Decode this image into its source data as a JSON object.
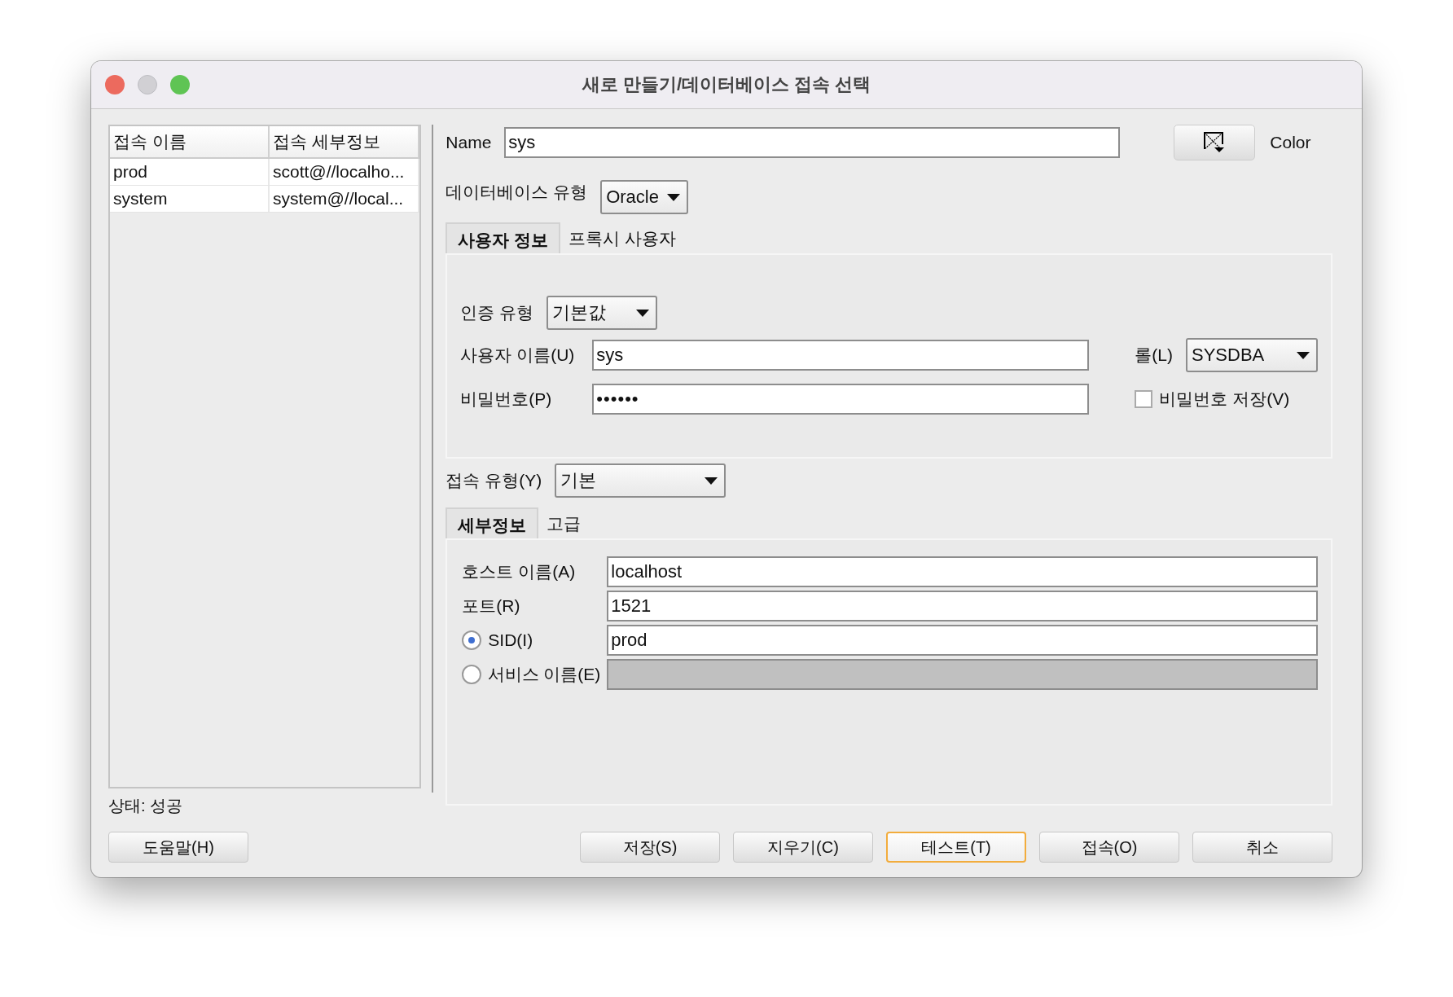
{
  "window": {
    "title": "새로 만들기/데이터베이스 접속 선택"
  },
  "connections": {
    "columns": [
      "접속 이름",
      "접속 세부정보"
    ],
    "rows": [
      {
        "name": "prod",
        "details": "scott@//localho..."
      },
      {
        "name": "system",
        "details": "system@//local..."
      }
    ]
  },
  "name": {
    "label": "Name",
    "value": "sys"
  },
  "color": {
    "label": "Color"
  },
  "database_type": {
    "label": "데이터베이스 유형",
    "value": "Oracle"
  },
  "user_tabs": [
    {
      "label": "사용자 정보",
      "selected": true
    },
    {
      "label": "프록시 사용자",
      "selected": false
    }
  ],
  "auth_type": {
    "label": "인증 유형",
    "value": "기본값"
  },
  "username": {
    "label": "사용자 이름(U)",
    "value": "sys"
  },
  "role": {
    "label": "롤(L)",
    "value": "SYSDBA"
  },
  "password": {
    "label": "비밀번호(P)",
    "value": "••••••"
  },
  "save_password": {
    "label": "비밀번호 저장(V)",
    "checked": false
  },
  "connection_type": {
    "label": "접속 유형(Y)",
    "value": "기본"
  },
  "detail_tabs": [
    {
      "label": "세부정보",
      "selected": true
    },
    {
      "label": "고급",
      "selected": false
    }
  ],
  "host": {
    "label": "호스트 이름(A)",
    "value": "localhost"
  },
  "port": {
    "label": "포트(R)",
    "value": "1521"
  },
  "sid": {
    "label": "SID(I)",
    "selected": true,
    "value": "prod",
    "disabled": false
  },
  "service_name": {
    "label": "서비스 이름(E)",
    "selected": false,
    "disabled": true
  },
  "status": "상태: 성공",
  "help_button": {
    "label": "도움말(H)",
    "focused": false
  },
  "buttons": [
    {
      "label": "저장(S)",
      "focused": false
    },
    {
      "label": "지우기(C)",
      "focused": false
    },
    {
      "label": "테스트(T)",
      "focused": true
    },
    {
      "label": "접속(O)",
      "focused": false
    },
    {
      "label": "취소",
      "focused": false
    }
  ]
}
